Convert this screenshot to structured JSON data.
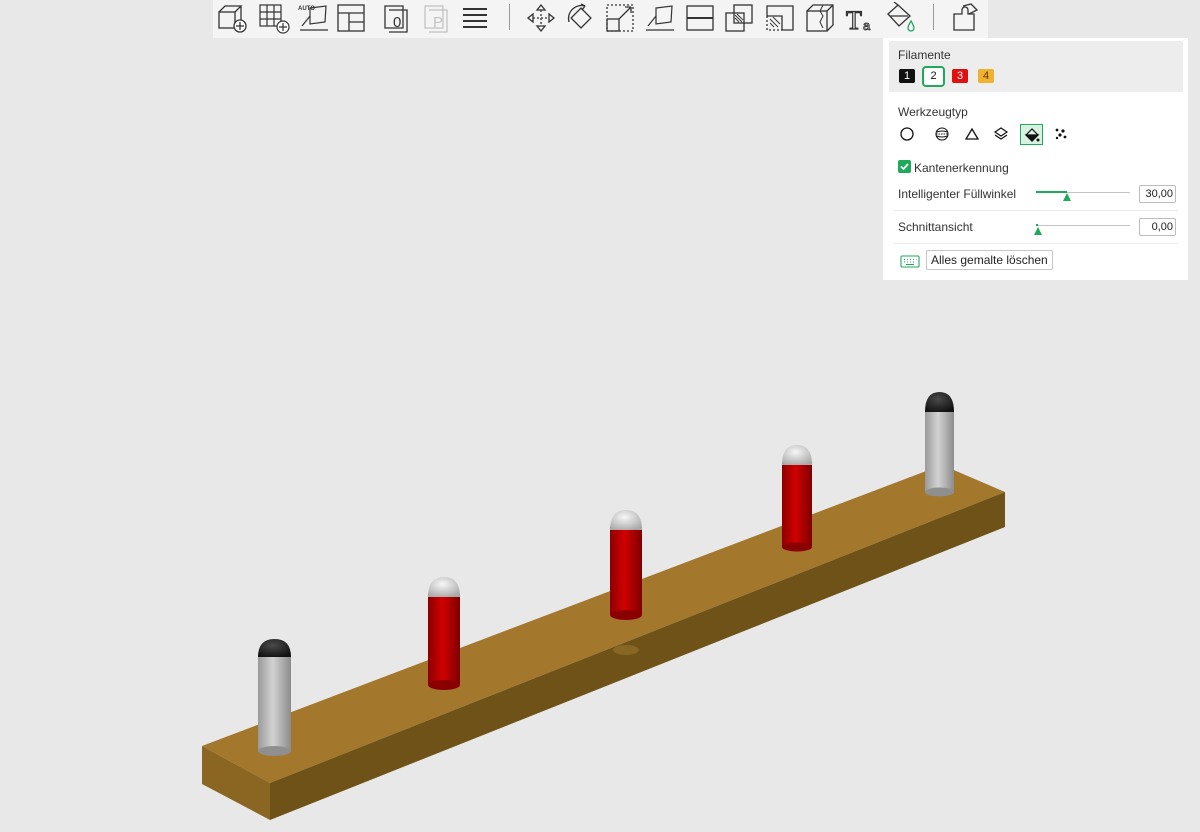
{
  "toolbar": {
    "buttons": [
      {
        "name": "add-object-icon"
      },
      {
        "name": "add-plate-icon"
      },
      {
        "name": "auto-orient-icon",
        "text": "AUTO"
      },
      {
        "name": "arrange-icon"
      },
      {
        "name": "slicing-plate-icon",
        "text": "0"
      },
      {
        "name": "plate-p-icon",
        "text": "P"
      },
      {
        "name": "layers-icon"
      },
      {
        "name": "move-icon"
      },
      {
        "name": "rotate-icon"
      },
      {
        "name": "scale-icon"
      },
      {
        "name": "lay-on-face-icon"
      },
      {
        "name": "cut-icon"
      },
      {
        "name": "boolean-icon"
      },
      {
        "name": "support-paint-icon"
      },
      {
        "name": "seam-paint-icon"
      },
      {
        "name": "text-icon",
        "text": "T",
        "subtext": "a"
      },
      {
        "name": "color-paint-icon"
      },
      {
        "name": "assembly-icon"
      }
    ]
  },
  "panel": {
    "filament_title": "Filamente",
    "filaments": [
      {
        "label": "1",
        "color": "#111111",
        "text_color": "#ffffff"
      },
      {
        "label": "2",
        "color": "#ffffff",
        "text_color": "#111111",
        "selected": true
      },
      {
        "label": "3",
        "color": "#e01010",
        "text_color": "#ffffff"
      },
      {
        "label": "4",
        "color": "#f0b030",
        "text_color": "#5a3a00"
      }
    ],
    "tool_type_title": "Werkzeugtyp",
    "tools": [
      {
        "name": "circle-tool-icon"
      },
      {
        "name": "sphere-tool-icon"
      },
      {
        "name": "triangle-tool-icon"
      },
      {
        "name": "height-range-tool-icon"
      },
      {
        "name": "fill-tool-icon",
        "active": true
      },
      {
        "name": "gap-fill-tool-icon"
      }
    ],
    "edge_detection_label": "Kantenerkennung",
    "edge_detection_checked": true,
    "smart_fill_label": "Intelligenter Füllwinkel",
    "smart_fill_value": "30,00",
    "smart_fill_fraction": 0.33,
    "section_view_label": "Schnittansicht",
    "section_view_value": "0,00",
    "section_view_fraction": 0.02,
    "clear_button_label": "Alles gemalte löschen",
    "accent_color": "#1ea95b"
  },
  "scene": {
    "base_color": "#a07a2c",
    "pegs": [
      {
        "body": "#b9b9b9",
        "cap": "#1e1e1e"
      },
      {
        "body": "#c40000",
        "cap": "#e4e4e4"
      },
      {
        "body": "#c40000",
        "cap": "#e4e4e4"
      },
      {
        "body": "#c40000",
        "cap": "#e4e4e4"
      },
      {
        "body": "#b9b9b9",
        "cap": "#1e1e1e"
      }
    ]
  }
}
